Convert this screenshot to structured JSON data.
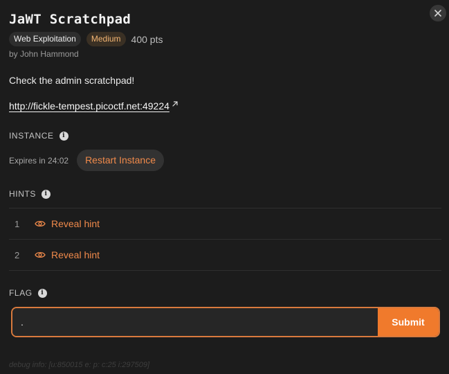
{
  "challenge": {
    "title": "JaWT Scratchpad",
    "category": "Web Exploitation",
    "difficulty": "Medium",
    "points": "400 pts",
    "author": "by John Hammond",
    "description": "Check the admin scratchpad!",
    "link": "http://fickle-tempest.picoctf.net:49224"
  },
  "instance": {
    "label": "INSTANCE",
    "expires": "Expires in 24:02",
    "restart_label": "Restart Instance"
  },
  "hints": {
    "label": "HINTS",
    "items": [
      {
        "number": "1",
        "label": "Reveal hint"
      },
      {
        "number": "2",
        "label": "Reveal hint"
      }
    ]
  },
  "flag": {
    "label": "FLAG",
    "value": ".",
    "submit_label": "Submit"
  },
  "debug": "debug info: [u:850015 e: p: c:25 i:297509]",
  "icons": {
    "close": "close-icon",
    "external": "external-link-icon",
    "info": "info-icon",
    "eye": "eye-icon"
  },
  "colors": {
    "background": "#1c1c1c",
    "accent": "#f07a2c",
    "accent_text": "#f08a4b",
    "difficulty_text": "#f3b573"
  }
}
